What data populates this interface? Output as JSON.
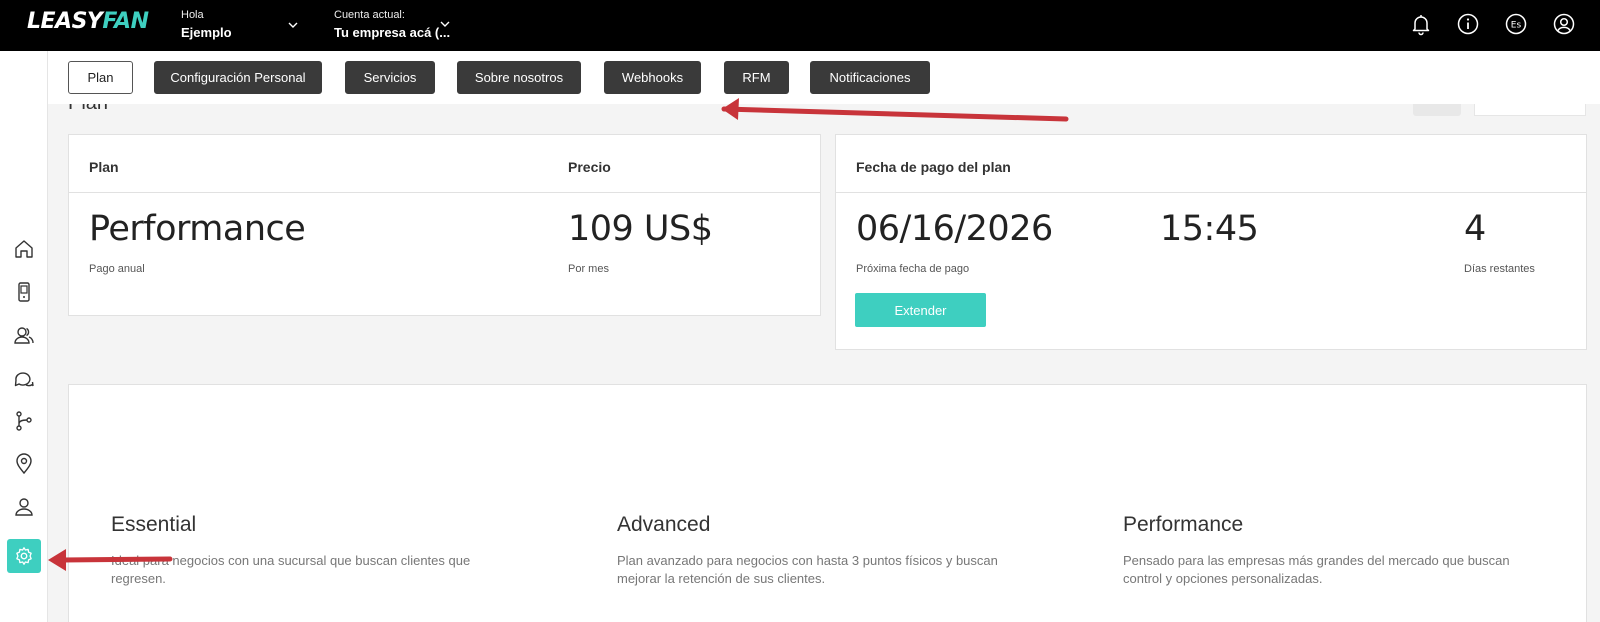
{
  "brand": {
    "logo_part1": "LEASY",
    "logo_part2": "FAN"
  },
  "header": {
    "greeting_label": "Hola",
    "user_name": "Ejemplo",
    "account_label": "Cuenta actual:",
    "account_name": "Tu empresa acá (...",
    "language": "Es"
  },
  "tabs": [
    {
      "label": "Plan",
      "active": true
    },
    {
      "label": "Configuración Personal",
      "active": false
    },
    {
      "label": "Servicios",
      "active": false
    },
    {
      "label": "Sobre nosotros",
      "active": false
    },
    {
      "label": "Webhooks",
      "active": false
    },
    {
      "label": "RFM",
      "active": false
    },
    {
      "label": "Notificaciones",
      "active": false
    }
  ],
  "page": {
    "title": "Plan"
  },
  "sidebar_icons": [
    "home-icon",
    "devices-icon",
    "customers-icon",
    "chat-icon",
    "flows-icon",
    "location-icon",
    "user-icon",
    "settings-icon"
  ],
  "plan_card": {
    "plan_header": "Plan",
    "price_header": "Precio",
    "plan_value": "Performance",
    "plan_sub": "Pago anual",
    "price_value": "109 US$",
    "price_sub": "Por mes"
  },
  "payment_card": {
    "header": "Fecha de pago del plan",
    "date_value": "06/16/2026",
    "date_sub": "Próxima fecha de pago",
    "time_value": "15:45",
    "days_value": "4",
    "days_sub": "Días restantes",
    "extend_label": "Extender"
  },
  "plans": [
    {
      "name": "Essential",
      "description": "Ideal para negocios con una sucursal que buscan clientes que regresen."
    },
    {
      "name": "Advanced",
      "description": "Plan avanzado para negocios con hasta 3 puntos físicos y buscan mejorar la retención de sus clientes."
    },
    {
      "name": "Performance",
      "description": "Pensado para las empresas más grandes del mercado que buscan control y opciones personalizadas."
    }
  ],
  "colors": {
    "accent": "#3ecfc0",
    "topbar": "#000000",
    "tab_dark": "#3a3a3a",
    "annotation_arrow": "#c8343a"
  }
}
